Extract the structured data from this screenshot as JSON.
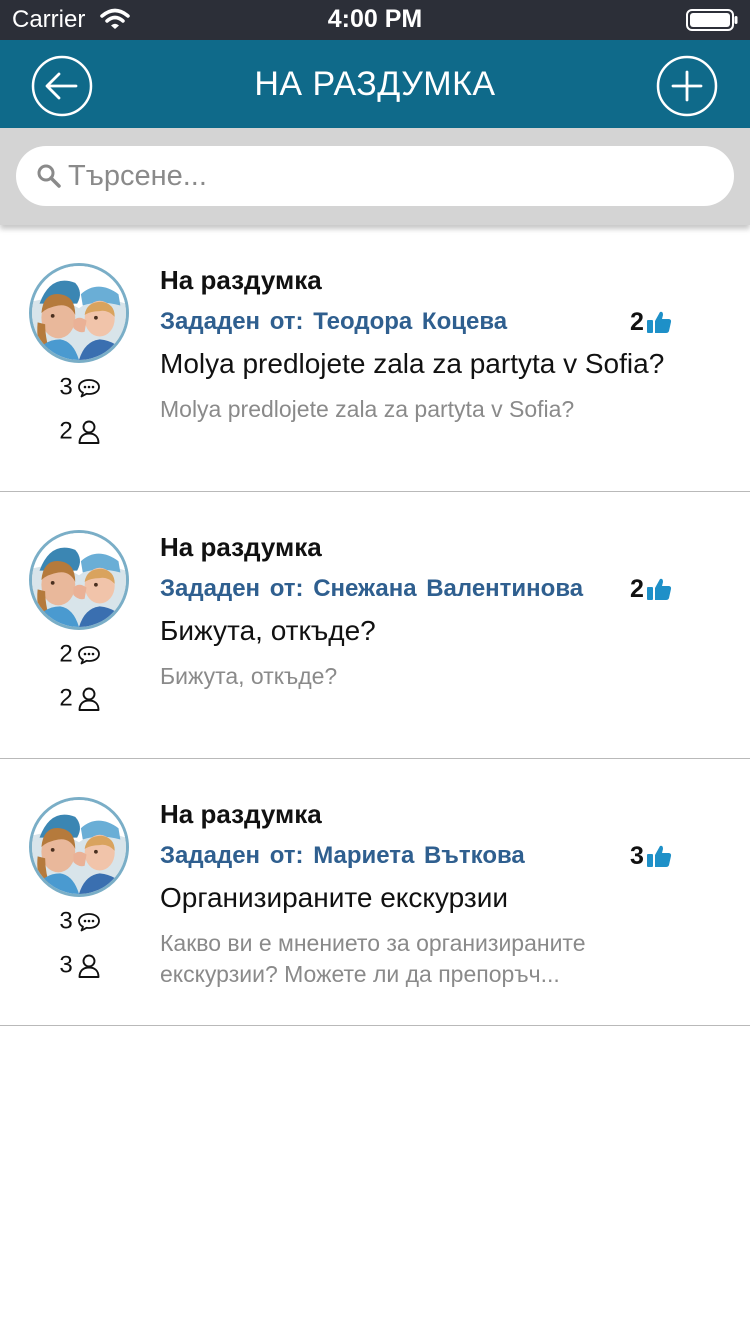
{
  "status_bar": {
    "carrier": "Carrier",
    "time": "4:00 PM"
  },
  "nav": {
    "title": "НА РАЗДУМКА",
    "back_icon": "arrow-left-circle-icon",
    "add_icon": "plus-circle-icon",
    "color": "#0f6a8a"
  },
  "search": {
    "placeholder": "Търсене...",
    "value": ""
  },
  "topics": [
    {
      "category": "На раздумка",
      "author": "Зададен от: Теодора  Коцева",
      "likes": "2",
      "title": "Molya predlojete zala za partyta v Sofia?",
      "preview": "Molya predlojete zala za partyta v Sofia?",
      "comments": "3",
      "participants": "2"
    },
    {
      "category": "На раздумка",
      "author": "Зададен от: Снежана  Валентинова",
      "likes": "2",
      "title": "Бижута, откъде?",
      "preview": "Бижута, откъде?",
      "comments": "2",
      "participants": "2"
    },
    {
      "category": "На раздумка",
      "author": "Зададен от: Мариета  Въткова",
      "likes": "3",
      "title": "Организираните екскурзии",
      "preview": "Какво ви е мнението за организираните екскурзии? Можете ли да препоръч...",
      "comments": "3",
      "participants": "3"
    }
  ],
  "colors": {
    "author": "#2f5f8f",
    "like_icon": "#1e90c8",
    "status_bar": "#2c2f38",
    "search_area": "#d4d4d4"
  }
}
